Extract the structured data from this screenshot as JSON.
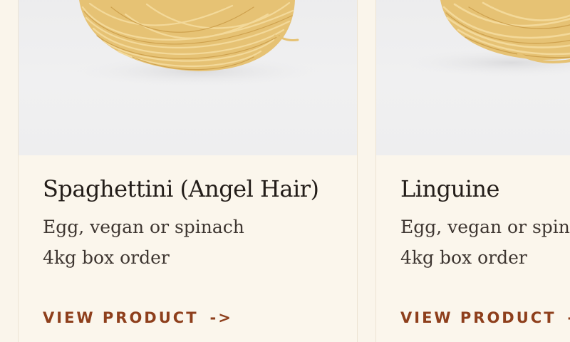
{
  "products": [
    {
      "name": "Spaghettini (Angel Hair)",
      "variants": "Egg, vegan or spinach",
      "order": "4kg box order",
      "cta": "VIEW PRODUCT",
      "arrow": "->"
    },
    {
      "name": "Linguine",
      "variants": "Egg, vegan or spinach",
      "order": "4kg box order",
      "cta": "VIEW PRODUCT",
      "arrow": "->"
    }
  ],
  "colors": {
    "page_bg": "#faf5eb",
    "card_bg": "#fbf6ec",
    "title_text": "#231d19",
    "body_text": "#3e3631",
    "cta_accent": "#8e3f1c",
    "pasta": "#e8c67a"
  }
}
